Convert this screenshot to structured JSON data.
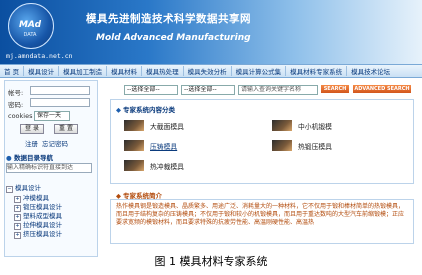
{
  "header": {
    "logo_text": "MAd",
    "logo_sub": "DATA",
    "title_cn": "模具先进制造技术科学数据共享网",
    "title_en": "Mold Advanced Manufacturing",
    "url": "mj.amndata.net.cn"
  },
  "nav": {
    "items": [
      "首 页",
      "模具设计",
      "模具加工制造",
      "模具材料",
      "模具热处理",
      "模具失效分析",
      "模具计算公式集",
      "模具材料专家系统",
      "模具技术论坛"
    ]
  },
  "login": {
    "account_label": "帐号:",
    "password_label": "密码:",
    "cookies_label": "cookies",
    "cookies_value": "保存一天",
    "login_button": "登 录",
    "reset_button": "重 置",
    "register_link": "注册",
    "forgot_link": "忘记密码"
  },
  "directory": {
    "title": "数据目录导航",
    "search_placeholder": "输入精确标识符直接到达",
    "root": "模具设计",
    "items": [
      "冲模模具",
      "锻压模具设计",
      "塑料成型模具",
      "拉伸模具设计",
      "挤压模具设计"
    ]
  },
  "search": {
    "select1": "--选择全部--",
    "select2": "--选择全部--",
    "keyword_placeholder": "请输入查询关键字名称",
    "search_btn": "SEARCH",
    "advanced_btn": "ADVANCED SEARCH"
  },
  "systems": {
    "title": "专家系统内容分类",
    "items": [
      "大截面模具",
      "中小机锻模",
      "压铸模具",
      "热锻压模具",
      "热冲裁模具"
    ]
  },
  "intro": {
    "title": "专家系统简介",
    "text": "热作模具钢是锻造模具、晶质繁多、用途广泛、消耗量大的一种材料，它不仅用于锻和棒材简单的热锻模具，而且用于结构复杂的压铸模具；不仅用于锻和较小的机锻模具，而且用于重达数吨的大型汽车前缩锻模；正应要求宽频的模锻材料，而且要求特殊的抗疲劳性能、高温刚硬性能、高温热"
  },
  "caption": "图 1  模具材料专家系统"
}
